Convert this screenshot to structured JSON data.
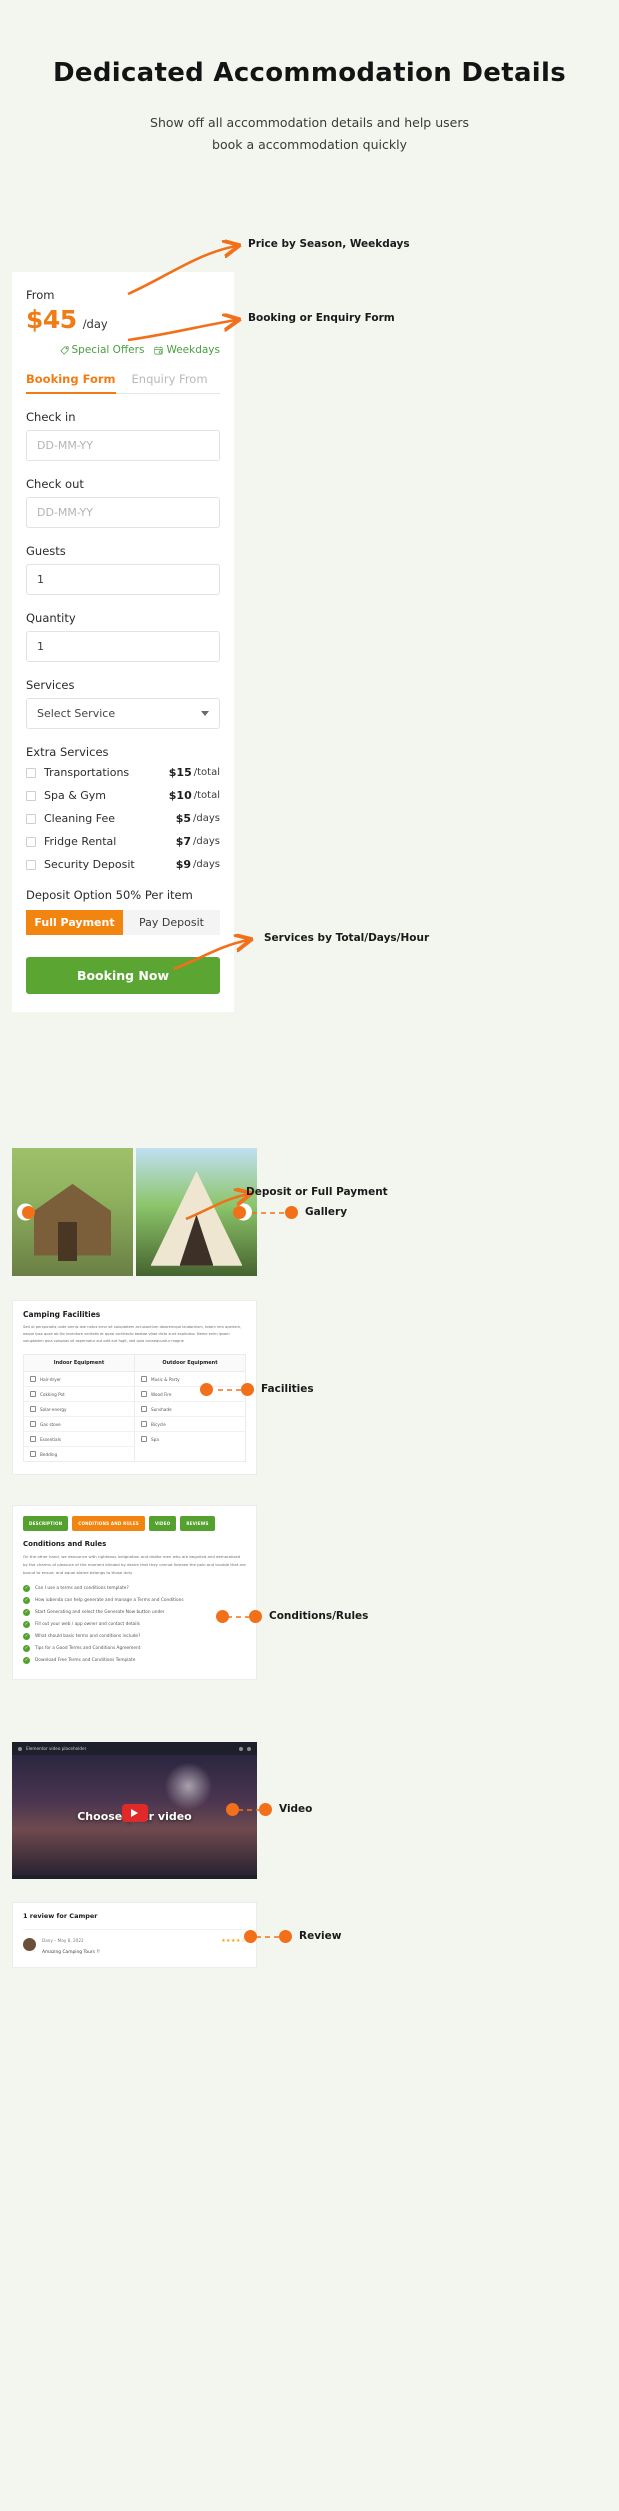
{
  "header": {
    "title": "Dedicated Accommodation Details",
    "subtitle_line1": "Show off all accommodation details and help users",
    "subtitle_line2": "book a accommodation quickly"
  },
  "colors": {
    "page_bg": "#f2f6ef",
    "accent_orange": "#f2850f",
    "price_orange": "#f07c16",
    "green_button": "#5ba533",
    "badge_green": "#4a9e3f",
    "annotation_orange": "#f2701a"
  },
  "booking_card": {
    "from_label": "From",
    "price": "$45",
    "price_unit": "/day",
    "badges": [
      {
        "icon": "tag-icon",
        "label": "Special Offers"
      },
      {
        "icon": "calendar-clock-icon",
        "label": "Weekdays"
      }
    ],
    "tabs": [
      {
        "label": "Booking Form",
        "active": true
      },
      {
        "label": "Enquiry From",
        "active": false
      }
    ],
    "fields": [
      {
        "label": "Check in",
        "value": "",
        "placeholder": "DD-MM-YY",
        "type": "date"
      },
      {
        "label": "Check out",
        "value": "",
        "placeholder": "DD-MM-YY",
        "type": "date"
      },
      {
        "label": "Guests",
        "value": "1",
        "placeholder": "",
        "type": "number"
      },
      {
        "label": "Quantity",
        "value": "1",
        "placeholder": "",
        "type": "number"
      }
    ],
    "services": {
      "label": "Services",
      "selected": "Select Service"
    },
    "extra_services": {
      "heading": "Extra Services",
      "items": [
        {
          "name": "Transportations",
          "price": "$15",
          "unit": "/total",
          "checked": false
        },
        {
          "name": "Spa & Gym",
          "price": "$10",
          "unit": "/total",
          "checked": false
        },
        {
          "name": "Cleaning Fee",
          "price": "$5",
          "unit": "/days",
          "checked": false
        },
        {
          "name": "Fridge Rental",
          "price": "$7",
          "unit": "/days",
          "checked": false
        },
        {
          "name": "Security Deposit",
          "price": "$9",
          "unit": "/days",
          "checked": false
        }
      ]
    },
    "deposit_line": "Deposit Option 50% Per item",
    "payment_options": [
      {
        "label": "Full Payment",
        "active": true
      },
      {
        "label": "Pay Deposit",
        "active": false
      }
    ],
    "book_button": "Booking Now"
  },
  "gallery": {
    "prev_icon": "chevron-left-icon",
    "next_icon": "chevron-right-icon",
    "prev_glyph": "‹",
    "next_glyph": "›"
  },
  "facilities": {
    "title": "Camping Facilities",
    "paragraph": "Sed ut perspiciatis unde omnis iste natus error sit voluptatem accusantium doloremque laudantium, totam rem aperiam, eaque ipsa quae ab illo inventore veritatis et quasi architecto beatae vitae dicta sunt explicabo. Nemo enim ipsam voluptatem quia voluptas sit aspernatur aut odit aut fugit, sed quia consequuntur magne",
    "columns": [
      {
        "header": "Indoor Equipment",
        "items": [
          "Hair-dryer",
          "Cokking Pot",
          "Solar-energy",
          "Gas stove",
          "Essentials",
          "Bedding"
        ]
      },
      {
        "header": "Outdoor Equipment",
        "items": [
          "Music & Party",
          "Wood Fire",
          "Sunshade",
          "Bicycle",
          "Spa"
        ]
      }
    ]
  },
  "conditions": {
    "tabs": [
      {
        "label": "DESCRIPTION",
        "active": false
      },
      {
        "label": "CONDITIONS AND RULES",
        "active": true
      },
      {
        "label": "VIDEO",
        "active": false
      },
      {
        "label": "REVIEWS",
        "active": false
      }
    ],
    "title": "Conditions and Rules",
    "paragraph": "On the other hand, we denounce with righteous indignation and dislike men who are beguiled and demoralized by the charms of pleasure of the moment blinded by desire that they cannot foresee the pain and trouble that are bound to ensue; and equal blame belongs to those duty",
    "list": [
      "Can I use a terms and conditions template?",
      "How iubenda can help generate and manage a Terms and Conditions",
      "Start Generating and select the Generate Now button under",
      "Fill out your web / app owner and contact details",
      "What should basic terms and conditions include?",
      "Tips for a Good Terms and Conditions Agreement",
      "Download Free Terms and Conditions Template"
    ]
  },
  "video": {
    "placeholder_label": "Elementor video placeholder",
    "overlay_text": "Choose your video",
    "play_icon": "play-icon"
  },
  "review": {
    "heading": "1 review for Camper",
    "author_date": "Dany – May 8, 2022",
    "text": "Amazing Camping Tours !!",
    "stars": "★★★★☆"
  },
  "annotations": [
    {
      "label": "Price by Season, Weekdays"
    },
    {
      "label": "Booking or Enquiry Form"
    },
    {
      "label": "Services by Total/Days/Hour"
    },
    {
      "label": "Deposit or Full Payment"
    },
    {
      "label": "Gallery"
    },
    {
      "label": "Facilities"
    },
    {
      "label": "Conditions/Rules"
    },
    {
      "label": "Video"
    },
    {
      "label": "Review"
    }
  ]
}
